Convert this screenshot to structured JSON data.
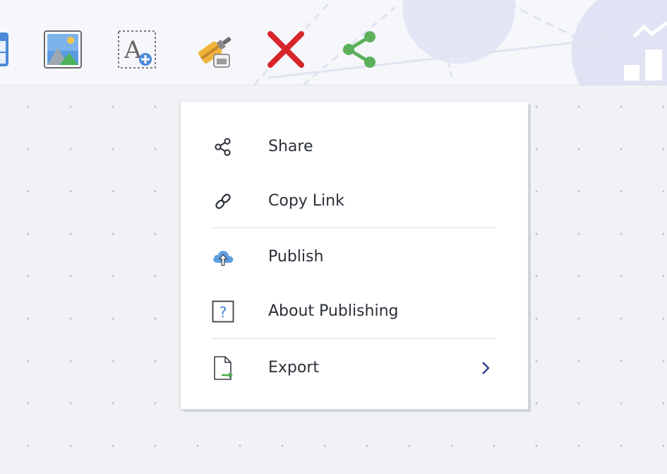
{
  "toolbar": {
    "tools": [
      {
        "icon": "table-icon",
        "color": "#4a8ad8"
      },
      {
        "icon": "image-icon",
        "color": "#4a8ad8"
      },
      {
        "icon": "add-text-icon",
        "color": "#5a5a5a"
      },
      {
        "icon": "format-painter-icon",
        "color": "#e0a632"
      },
      {
        "icon": "delete-icon",
        "color": "#d6262c"
      },
      {
        "icon": "share-icon",
        "color": "#5cb05c"
      }
    ]
  },
  "menu": {
    "items": [
      {
        "label": "Share",
        "icon": "share-icon"
      },
      {
        "label": "Copy Link",
        "icon": "link-icon"
      },
      {
        "label": "Publish",
        "icon": "cloud-upload-icon"
      },
      {
        "label": "About Publishing",
        "icon": "question-icon"
      },
      {
        "label": "Export",
        "icon": "export-file-icon",
        "submenu": true
      }
    ]
  },
  "colors": {
    "menu_text": "#2b2f38",
    "accent_blue": "#4a8ad8",
    "submenu_arrow": "#2e3f8c",
    "canvas_bg": "#f1f2f5"
  }
}
